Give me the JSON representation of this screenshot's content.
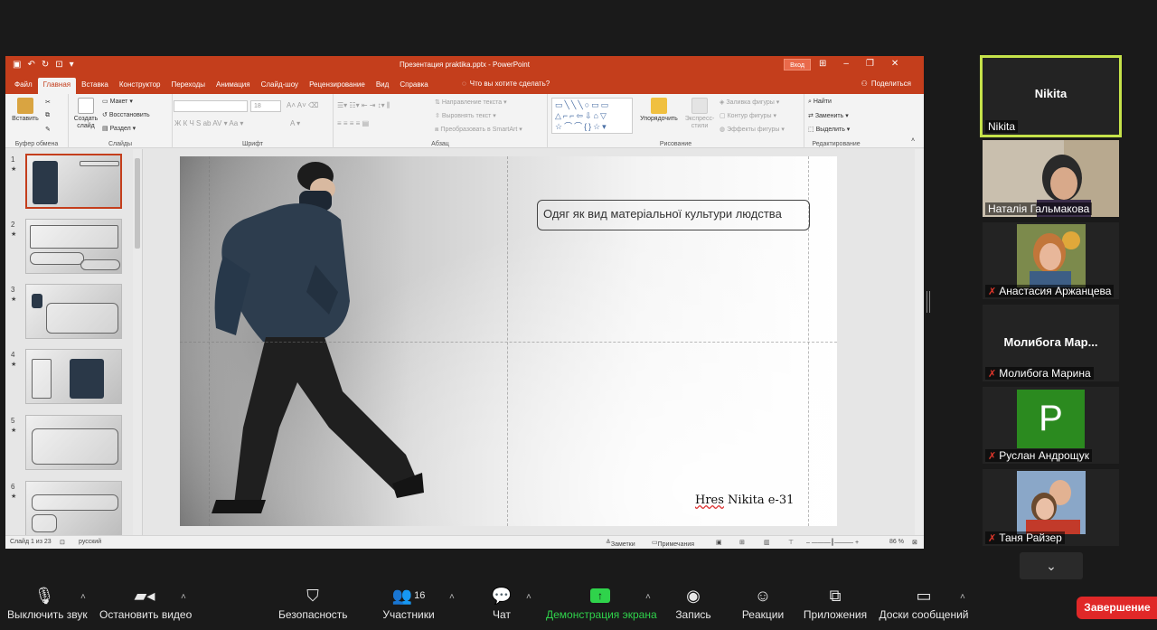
{
  "powerpoint": {
    "doc_title": "Презентация praktika.pptx  -  PowerPoint",
    "signin_label": "Вход",
    "menu_tabs": [
      "Файл",
      "Главная",
      "Вставка",
      "Конструктор",
      "Переходы",
      "Анимация",
      "Слайд-шоу",
      "Рецензирование",
      "Вид",
      "Справка"
    ],
    "active_tab": "Главная",
    "tell_me": "Что вы хотите сделать?",
    "share_label": "Поделиться",
    "ribbon": {
      "paste": "Вставить",
      "clipboard_group": "Буфер обмена",
      "new_slide": "Создать слайд",
      "layout": "Макет",
      "reset": "Восстановить",
      "section": "Раздел",
      "slides_group": "Слайды",
      "font_size": "18",
      "font_group": "Шрифт",
      "text_direction": "Направление текста",
      "align_text": "Выровнять текст",
      "smartart": "Преобразовать в SmartArt",
      "paragraph_group": "Абзац",
      "arrange": "Упорядочить",
      "quick_styles": "Экспресс-стили",
      "shape_fill": "Заливка фигуры",
      "shape_outline": "Контур фигуры",
      "shape_effects": "Эффекты фигуры",
      "drawing_group": "Рисование",
      "find": "Найти",
      "replace": "Заменить",
      "select": "Выделить",
      "editing_group": "Редактирование"
    },
    "slides": [
      {
        "num": "1"
      },
      {
        "num": "2"
      },
      {
        "num": "3"
      },
      {
        "num": "4"
      },
      {
        "num": "5"
      },
      {
        "num": "6"
      }
    ],
    "slide": {
      "title": "Одяг як вид матеріальної культури людства",
      "author_word1": "Hres",
      "author_rest": " Nikita e-31"
    },
    "status": {
      "slide_of": "Слайд 1 из 23",
      "language": "русский",
      "notes": "Заметки",
      "comments": "Примечания",
      "zoom": "86 %"
    }
  },
  "gallery": [
    {
      "name": "Nikita",
      "label": "Nikita",
      "muted": false,
      "active": true
    },
    {
      "name": "Наталія Гальмакова",
      "muted": false
    },
    {
      "name": "Анастасия Аржанцева",
      "muted": true
    },
    {
      "name": "Молибога Марина",
      "big": "Молибога  Мар...",
      "muted": true
    },
    {
      "name": "Руслан Андрощук",
      "initial": "P",
      "muted": true
    },
    {
      "name": "Таня Райзер",
      "muted": true
    }
  ],
  "toolbar": {
    "mute": "Выключить звук",
    "stop_video": "Остановить видео",
    "security": "Безопасность",
    "participants": "Участники",
    "participants_count": "16",
    "chat": "Чат",
    "share_screen": "Демонстрация экрана",
    "record": "Запись",
    "reactions": "Реакции",
    "apps": "Приложения",
    "whiteboards": "Доски сообщений",
    "end": "Завершение"
  },
  "colors": {
    "ppt_accent": "#c43e1c",
    "active_speaker": "#c5e24a",
    "share_green": "#2fd34b",
    "end_red": "#e02828"
  }
}
